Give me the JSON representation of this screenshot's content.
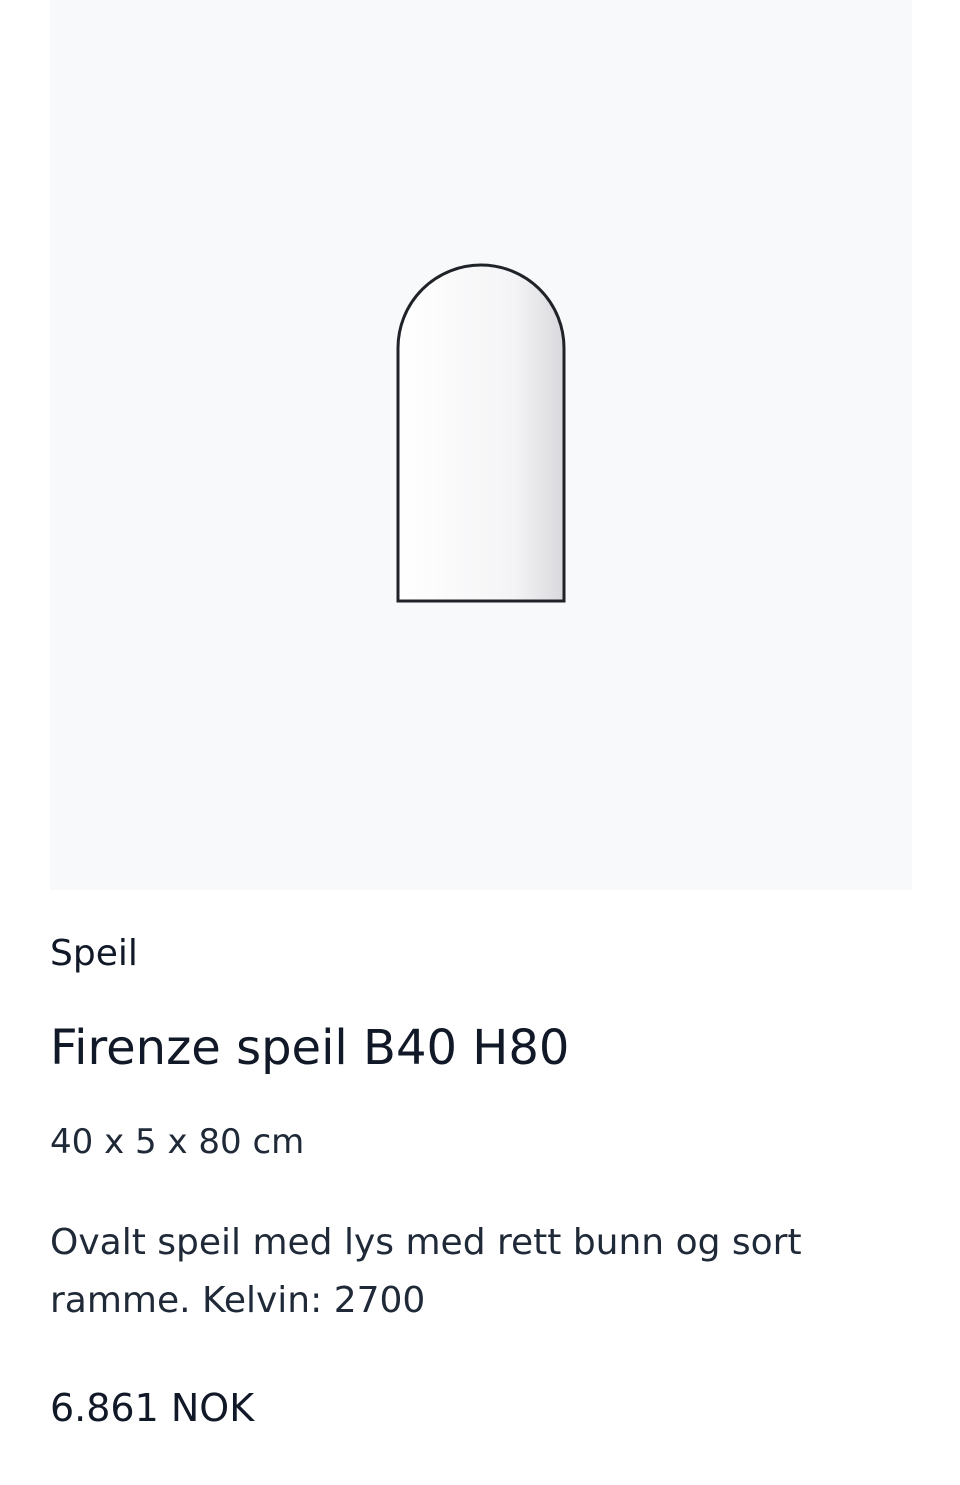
{
  "product": {
    "image_icon": "arched-mirror-icon",
    "category": "Speil",
    "title": "Firenze speil B40 H80",
    "dimensions": "40 x 5 x 80 cm",
    "description": "Ovalt speil med lys med rett bunn og sort ramme. Kelvin: 2700",
    "price": "6.861 NOK"
  },
  "colors": {
    "image_background": "#f8f9fb",
    "mirror_frame": "#1f2328",
    "text_primary": "#111827"
  }
}
